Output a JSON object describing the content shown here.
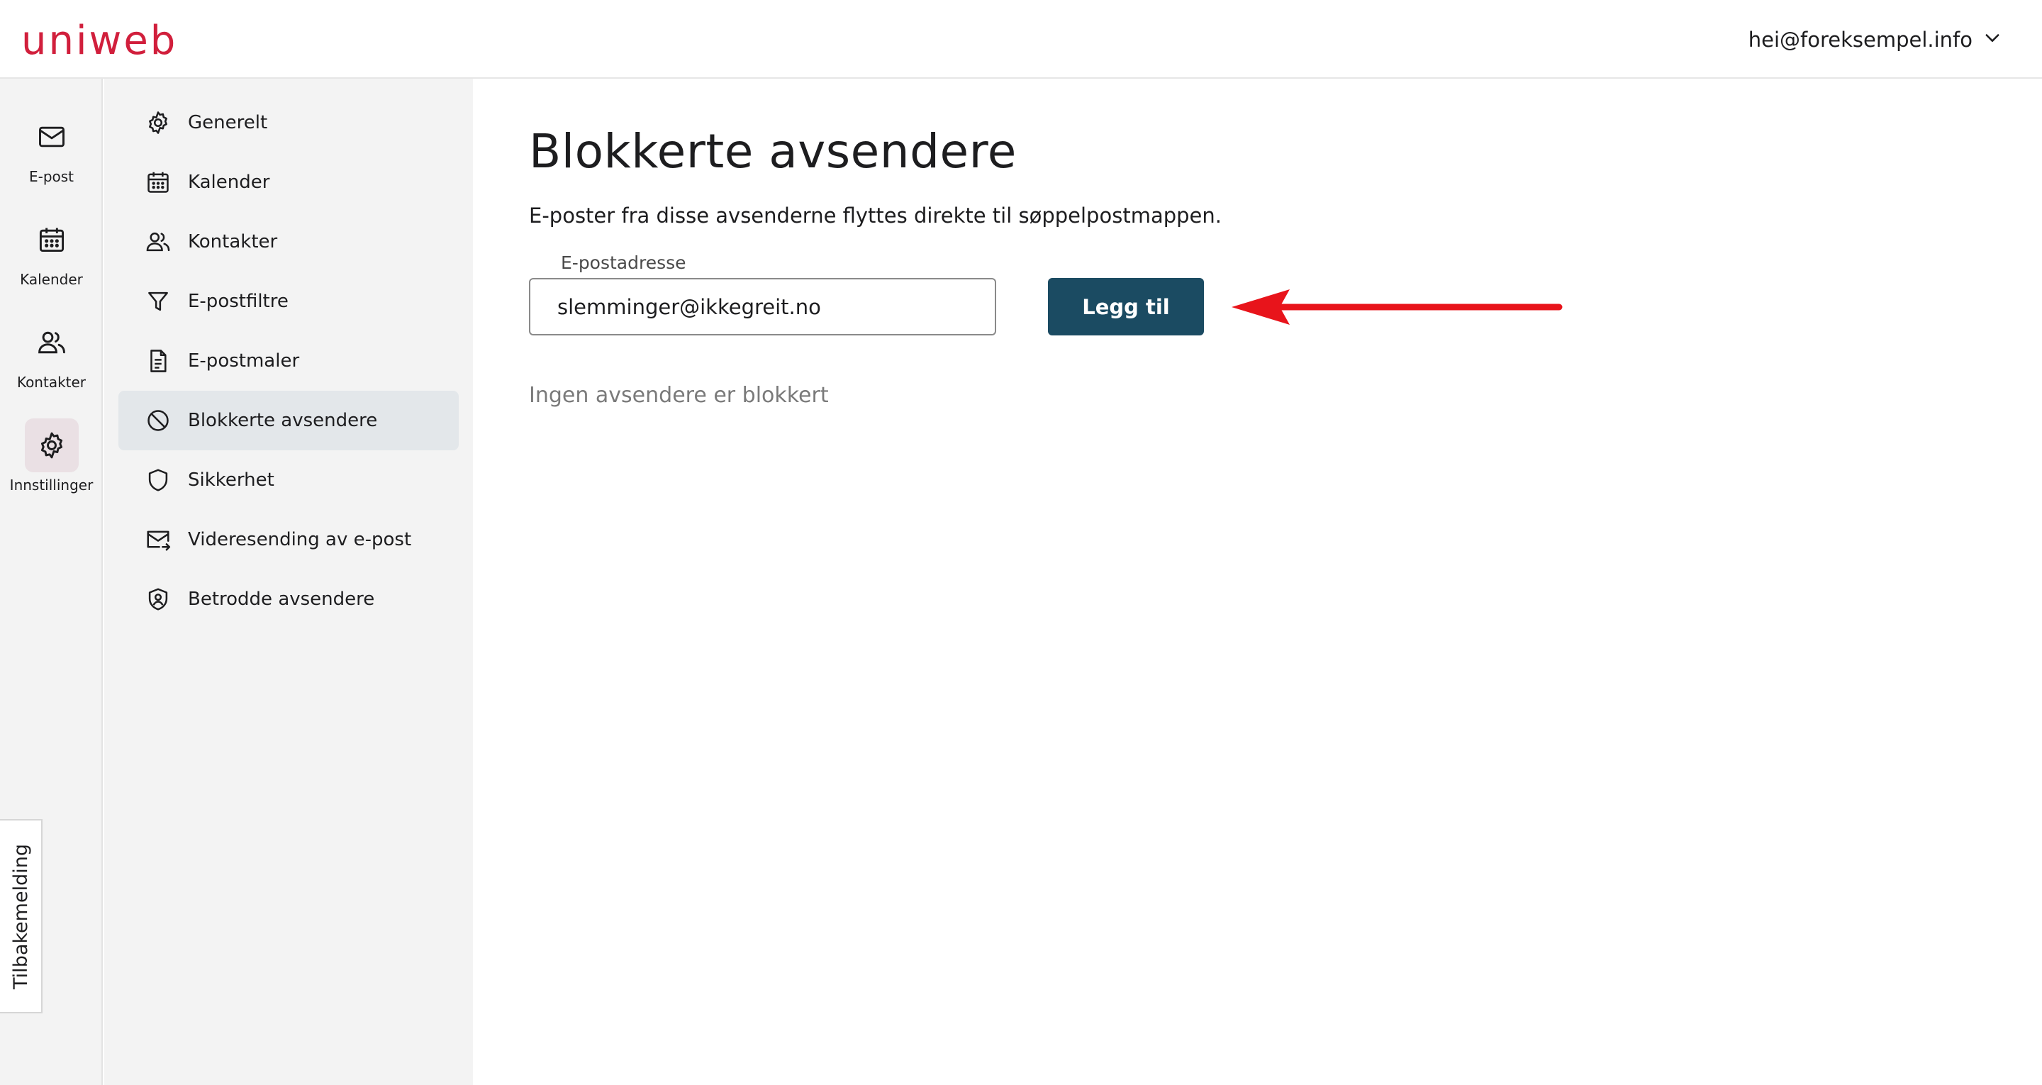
{
  "header": {
    "logo_text": "uniweb",
    "account_email": "hei@foreksempel.info"
  },
  "rail": {
    "items": [
      {
        "label": "E-post",
        "icon": "mail-icon"
      },
      {
        "label": "Kalender",
        "icon": "calendar-icon"
      },
      {
        "label": "Kontakter",
        "icon": "contacts-icon"
      },
      {
        "label": "Innstillinger",
        "icon": "gear-icon",
        "active": true
      }
    ],
    "feedback_label": "Tilbakemelding"
  },
  "settings_nav": {
    "items": [
      {
        "label": "Generelt",
        "icon": "gear-icon"
      },
      {
        "label": "Kalender",
        "icon": "calendar-icon"
      },
      {
        "label": "Kontakter",
        "icon": "contacts-icon"
      },
      {
        "label": "E-postfiltre",
        "icon": "filter-icon"
      },
      {
        "label": "E-postmaler",
        "icon": "document-icon"
      },
      {
        "label": "Blokkerte avsendere",
        "icon": "block-icon",
        "active": true
      },
      {
        "label": "Sikkerhet",
        "icon": "shield-icon"
      },
      {
        "label": "Videresending av e-post",
        "icon": "mail-forward-icon"
      },
      {
        "label": "Betrodde avsendere",
        "icon": "shield-user-icon"
      }
    ]
  },
  "main": {
    "title": "Blokkerte avsendere",
    "description": "E-poster fra disse avsenderne flyttes direkte til søppelpostmappen.",
    "email_field": {
      "label": "E-postadresse",
      "value": "slemminger@ikkegreit.no"
    },
    "add_button_label": "Legg til",
    "empty_state": "Ingen avsendere er blokkert"
  },
  "colors": {
    "brand": "#d11f3c",
    "primary_button": "#1b4b62",
    "annotation_arrow": "#e8141b",
    "active_nav": "#e3e7ea",
    "active_rail": "#eae0e4"
  }
}
